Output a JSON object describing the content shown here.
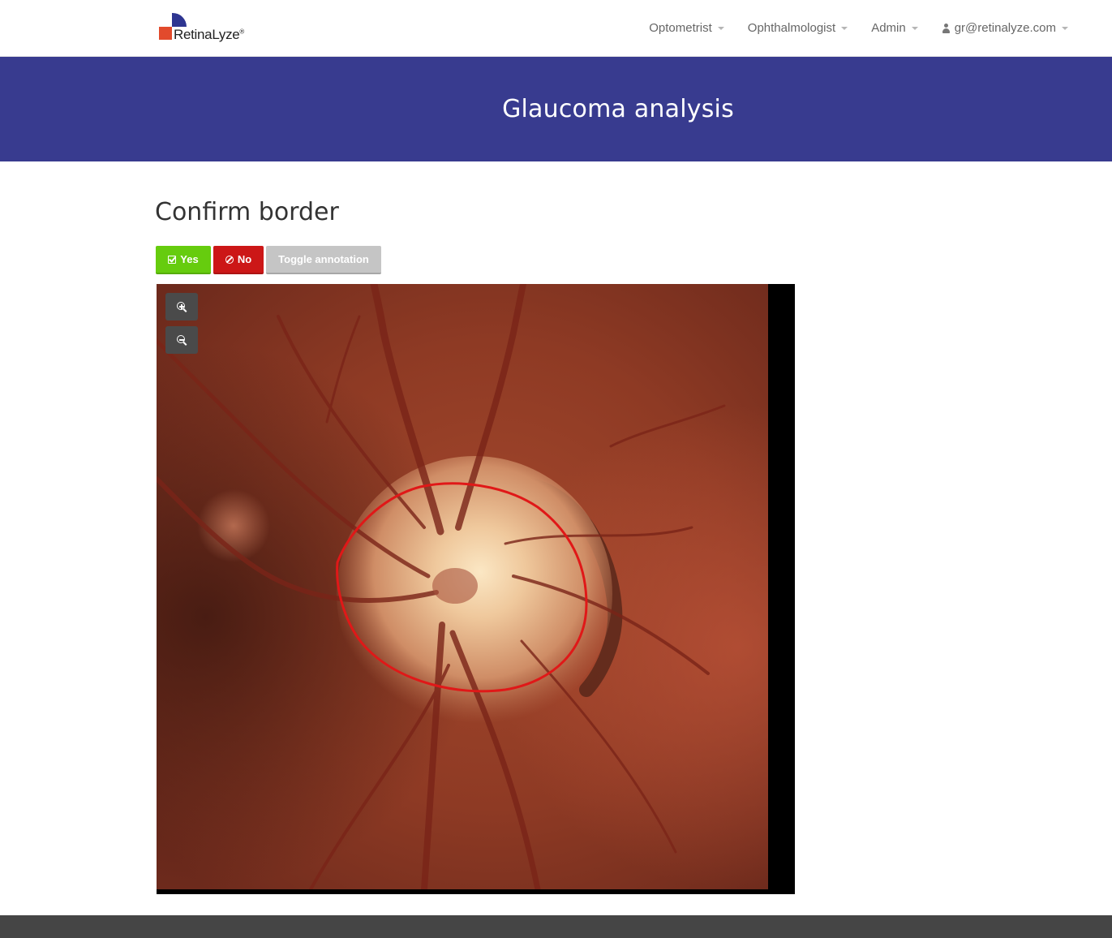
{
  "brand": {
    "name": "RetinaLyze",
    "registered": "®"
  },
  "nav": {
    "items": [
      {
        "label": "Optometrist"
      },
      {
        "label": "Ophthalmologist"
      },
      {
        "label": "Admin"
      }
    ],
    "user": {
      "email": "gr@retinalyze.com",
      "icon": "user-icon"
    }
  },
  "hero": {
    "title": "Glaucoma analysis"
  },
  "content": {
    "heading": "Confirm border",
    "buttons": {
      "yes": {
        "label": "Yes",
        "icon": "check-square-icon",
        "color": "#66cc0e"
      },
      "no": {
        "label": "No",
        "icon": "ban-icon",
        "color": "#cc1717"
      },
      "toggle": {
        "label": "Toggle annotation",
        "color": "#c5c5c5"
      }
    },
    "viewer": {
      "zoom_in_icon": "zoom-in-icon",
      "zoom_out_icon": "zoom-out-icon",
      "annotation_color": "#e01818"
    }
  },
  "colors": {
    "hero_bg": "#383b8f",
    "footer_bg": "#454545"
  }
}
